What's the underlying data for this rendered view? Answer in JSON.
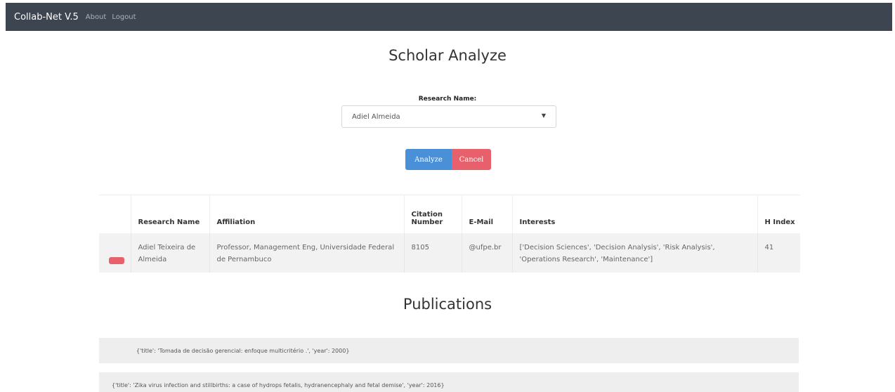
{
  "navbar": {
    "brand": "Collab-Net V.5",
    "links": [
      "About",
      "Logout"
    ]
  },
  "page": {
    "title": "Scholar Analyze"
  },
  "form": {
    "label": "Research Name:",
    "selected": "Adiel Almeida",
    "analyze_label": "Analyze",
    "cancel_label": "Cancel"
  },
  "table": {
    "headers": [
      "",
      "Research Name",
      "Affiliation",
      "Citation Number",
      "E-Mail",
      "Interests",
      "H Index"
    ],
    "row": {
      "name": "Adiel Teixeira de Almeida",
      "affiliation": "Professor, Management Eng, Universidade Federal de Pernambuco",
      "citations": "8105",
      "email": "@ufpe.br",
      "interests": "['Decision Sciences', 'Decision Analysis', 'Risk Analysis', 'Operations Research', 'Maintenance']",
      "h_index": "41"
    }
  },
  "publications": {
    "title": "Publications",
    "items": [
      "{'title': 'Tomada de decisão gerencial: enfoque multicritério .', 'year': 2000}",
      "{'title': 'Zika virus infection and stillbirths: a case of hydrops fetalis, hydranencephaly and fetal demise', 'year': 2016}"
    ]
  },
  "colors": {
    "navbar": "#3d4550",
    "primary": "#4a90d9",
    "danger": "#e8606c"
  }
}
